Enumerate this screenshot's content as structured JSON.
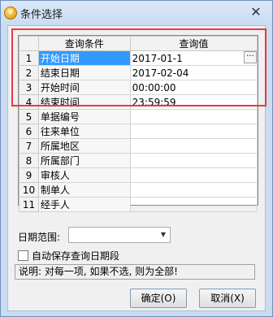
{
  "window": {
    "title": "条件选择",
    "close_symbol": "✕"
  },
  "grid": {
    "headers": [
      "查询条件",
      "查询值"
    ],
    "rows": [
      {
        "num": "1",
        "condition": "开始日期",
        "value": "2017-01-1",
        "button": "···"
      },
      {
        "num": "2",
        "condition": "结束日期",
        "value": "2017-02-04"
      },
      {
        "num": "3",
        "condition": "开始时间",
        "value": "00:00:00"
      },
      {
        "num": "4",
        "condition": "结束时间",
        "value": "23:59:59"
      },
      {
        "num": "5",
        "condition": "单据编号",
        "value": ""
      },
      {
        "num": "6",
        "condition": "往来单位",
        "value": ""
      },
      {
        "num": "7",
        "condition": "所属地区",
        "value": ""
      },
      {
        "num": "8",
        "condition": "所属部门",
        "value": ""
      },
      {
        "num": "9",
        "condition": "审核人",
        "value": ""
      },
      {
        "num": "10",
        "condition": "制单人",
        "value": ""
      },
      {
        "num": "11",
        "condition": "经手人",
        "value": ""
      }
    ]
  },
  "date_range": {
    "label": "日期范围:",
    "value": "",
    "arrow": "▼"
  },
  "autosave": {
    "label": "自动保存查询日期段",
    "checked": false
  },
  "note": "说明: 对每一项, 如果不选, 则为全部!",
  "buttons": {
    "ok": "确定(O)",
    "cancel": "取消(X)"
  },
  "icons": {
    "app": "coin-icon",
    "close": "close-icon",
    "dropdown": "chevron-down-icon"
  },
  "colors": {
    "title_bar": "#c9dcf2",
    "selection": "#3399ff",
    "highlight": "#e63a45"
  }
}
